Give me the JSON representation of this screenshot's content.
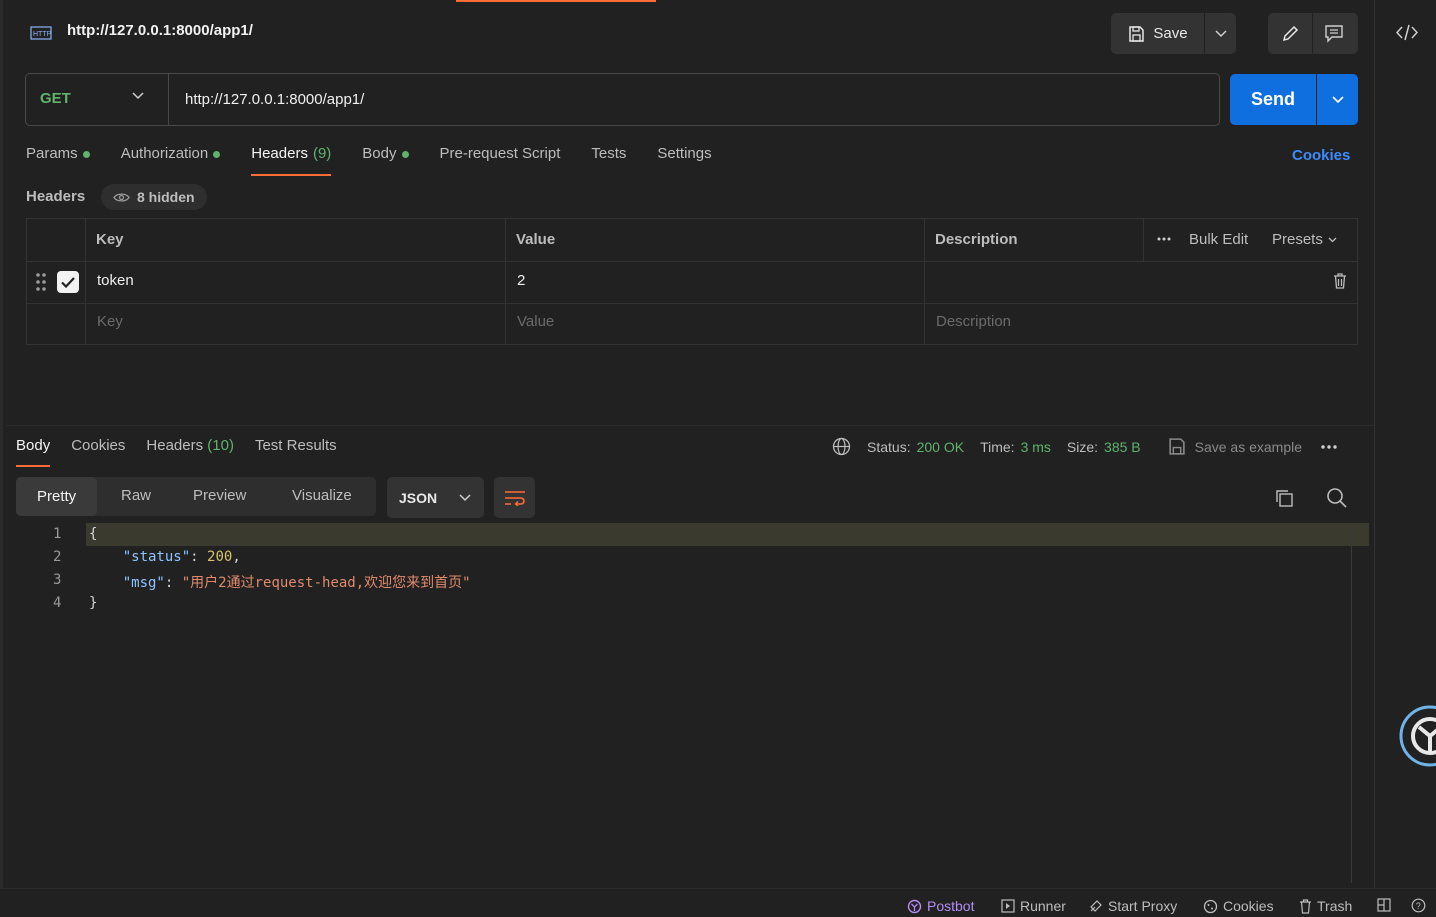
{
  "request": {
    "title": "http://127.0.0.1:8000/app1/",
    "method": "GET",
    "url": "http://127.0.0.1:8000/app1/",
    "save_label": "Save",
    "send_label": "Send"
  },
  "tabs": [
    {
      "label": "Params"
    },
    {
      "label": "Authorization"
    },
    {
      "label": "Headers",
      "count": "(9)"
    },
    {
      "label": "Body"
    },
    {
      "label": "Pre-request Script"
    },
    {
      "label": "Tests"
    },
    {
      "label": "Settings"
    }
  ],
  "cookies_link": "Cookies",
  "headers_section": {
    "label": "Headers",
    "hidden": "8 hidden",
    "columns": {
      "key": "Key",
      "value": "Value",
      "description": "Description"
    },
    "bulk_edit": "Bulk Edit",
    "presets": "Presets",
    "rows": [
      {
        "key": "token",
        "value": "2",
        "description": ""
      }
    ],
    "placeholders": {
      "key": "Key",
      "value": "Value",
      "description": "Description"
    }
  },
  "response": {
    "tabs": [
      {
        "label": "Body"
      },
      {
        "label": "Cookies"
      },
      {
        "label": "Headers",
        "count": "(10)"
      },
      {
        "label": "Test Results"
      }
    ],
    "status_label": "Status:",
    "status_value": "200 OK",
    "time_label": "Time:",
    "time_value": "3 ms",
    "size_label": "Size:",
    "size_value": "385 B",
    "save_example": "Save as example",
    "view_modes": [
      "Pretty",
      "Raw",
      "Preview",
      "Visualize"
    ],
    "format": "JSON",
    "code_lines": [
      "1",
      "2",
      "3",
      "4"
    ],
    "json": {
      "open": "{",
      "status_key": "\"status\"",
      "status_val": "200",
      "msg_key": "\"msg\"",
      "msg_val": "\"用户2通过request-head,欢迎您来到首页\"",
      "close": "}"
    }
  },
  "footer": {
    "postbot": "Postbot",
    "runner": "Runner",
    "proxy": "Start Proxy",
    "cookies": "Cookies",
    "trash": "Trash"
  },
  "colors": {
    "accent": "#ff6c37",
    "send": "#0f6fde",
    "success": "#5fb36b",
    "link": "#3d8bfd"
  }
}
